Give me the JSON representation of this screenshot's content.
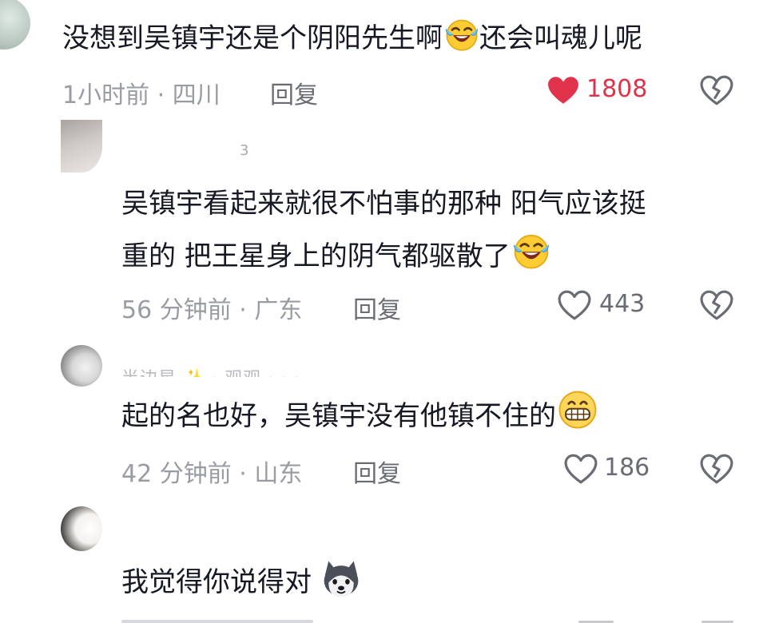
{
  "comments": [
    {
      "username": "",
      "text_lines": [
        "没想到吴镇宇还是个阴阳先生啊",
        "还会叫魂儿呢"
      ],
      "emoji": "laughing-crying",
      "time": "1小时前",
      "location": "四川",
      "reply_label": "回复",
      "likes": "1808",
      "liked": true
    },
    {
      "username": "3",
      "text_lines": [
        "吴镇宇看起来就很不怕事的那种 阳气应该挺",
        "重的 把王星身上的阴气都驱散了"
      ],
      "emoji": "laughing-crying",
      "time": "56 分钟前",
      "location": "广东",
      "reply_label": "回复",
      "likes": "443",
      "liked": false
    },
    {
      "username": "半边星 ✨ · 观观 · · ·",
      "text_lines": [
        "起的名也好，吴镇宇没有他镇不住的"
      ],
      "emoji": "grinning",
      "time": "42 分钟前",
      "location": "山东",
      "reply_label": "回复",
      "likes": "186",
      "liked": false
    },
    {
      "username": "",
      "text_lines": [
        "我觉得你说得对"
      ],
      "emoji": "husky-dog",
      "time": "",
      "location": "",
      "reply_label": "",
      "likes": "",
      "liked": false
    }
  ],
  "colors": {
    "liked": "#e0324a",
    "meta": "#9a9ca4",
    "text": "#161823"
  },
  "separator": " · "
}
